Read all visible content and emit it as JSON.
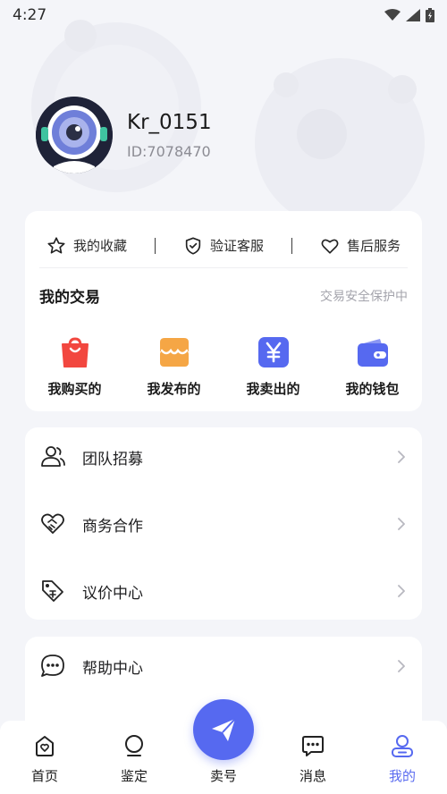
{
  "status": {
    "time": "4:27"
  },
  "profile": {
    "name": "Kr_0151",
    "id": "ID:7078470"
  },
  "quick_links": [
    {
      "label": "我的收藏",
      "icon": "star-icon"
    },
    {
      "label": "验证客服",
      "icon": "shield-check-icon"
    },
    {
      "label": "售后服务",
      "icon": "heart-icon"
    }
  ],
  "trade": {
    "title": "我的交易",
    "subtitle": "交易安全保护中",
    "items": [
      {
        "label": "我购买的",
        "icon": "shopping-bag-icon",
        "color": "#f2473f"
      },
      {
        "label": "我发布的",
        "icon": "store-icon",
        "color": "#f5a645"
      },
      {
        "label": "我卖出的",
        "icon": "yen-icon",
        "color": "#5669f0"
      },
      {
        "label": "我的钱包",
        "icon": "wallet-icon",
        "color": "#5669f0"
      }
    ]
  },
  "menu": [
    {
      "label": "团队招募",
      "icon": "users-icon"
    },
    {
      "label": "商务合作",
      "icon": "handshake-heart-icon"
    },
    {
      "label": "议价中心",
      "icon": "price-tag-icon"
    }
  ],
  "menu2": [
    {
      "label": "帮助中心",
      "icon": "chat-dots-icon"
    }
  ],
  "tabs": [
    {
      "label": "首页",
      "icon": "home-icon"
    },
    {
      "label": "鉴定",
      "icon": "magnifier-icon"
    },
    {
      "label": "卖号",
      "icon": "paper-plane-icon"
    },
    {
      "label": "消息",
      "icon": "message-icon"
    },
    {
      "label": "我的",
      "icon": "profile-icon",
      "active": true
    }
  ],
  "colors": {
    "accent": "#5669f0",
    "background": "#f4f5f9"
  }
}
